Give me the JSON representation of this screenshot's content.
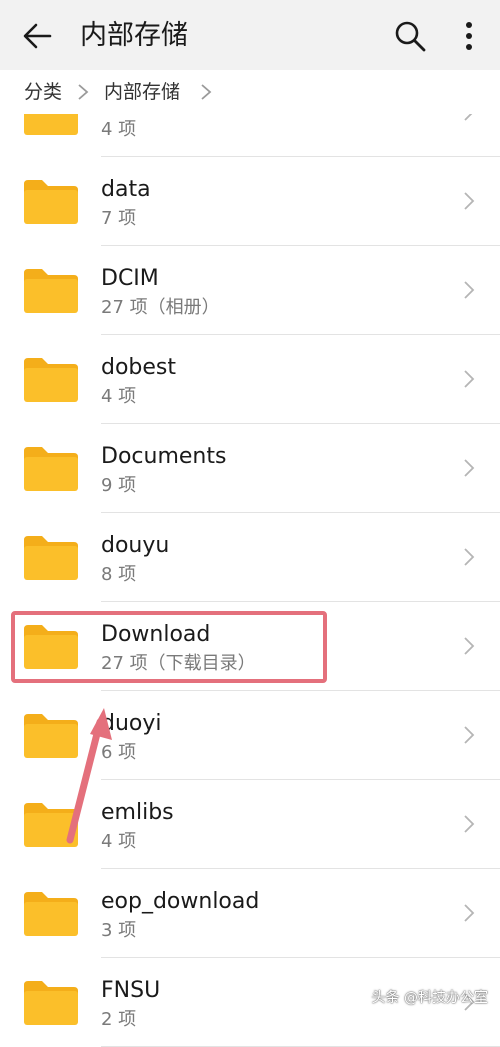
{
  "appbar": {
    "title": "内部存储",
    "back_icon": "arrow-left-icon",
    "search_icon": "search-icon",
    "more_icon": "more-vertical-icon"
  },
  "breadcrumb": {
    "items": [
      "分类",
      "内部存储"
    ]
  },
  "folders": [
    {
      "name": "",
      "sub": "4 项"
    },
    {
      "name": "data",
      "sub": "7 项"
    },
    {
      "name": "DCIM",
      "sub": "27 项（相册）"
    },
    {
      "name": "dobest",
      "sub": "4 项"
    },
    {
      "name": "Documents",
      "sub": "9 项"
    },
    {
      "name": "douyu",
      "sub": "8 项"
    },
    {
      "name": "Download",
      "sub": "27 项（下载目录）"
    },
    {
      "name": "duoyi",
      "sub": "6 项"
    },
    {
      "name": "emlibs",
      "sub": "4 项"
    },
    {
      "name": "eop_download",
      "sub": "3 项"
    },
    {
      "name": "FNSU",
      "sub": "2 项"
    }
  ],
  "colors": {
    "folder": "#fbbf2a",
    "folder_tab": "#f4ae1a",
    "highlight": "#e4707c"
  },
  "watermark": "头条 @科技办公室"
}
